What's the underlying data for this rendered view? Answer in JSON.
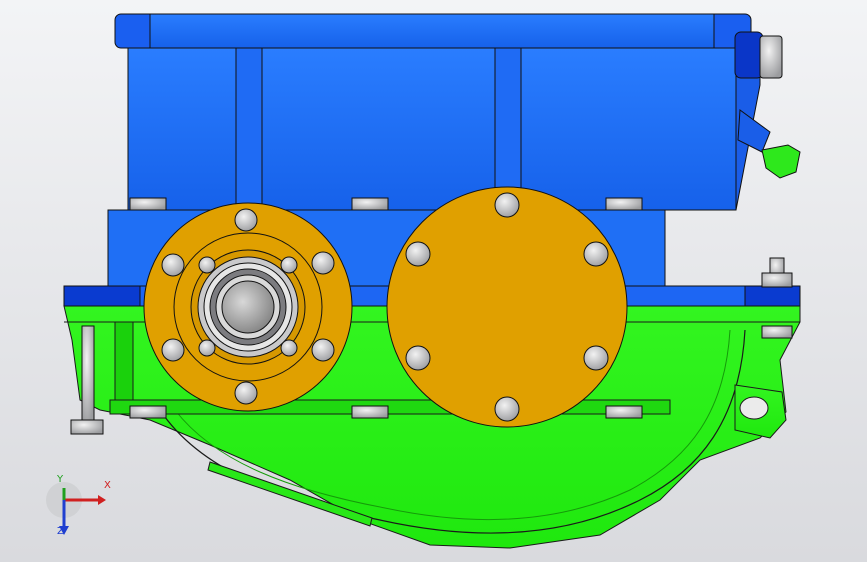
{
  "viewport": {
    "background": "#eceef1",
    "colors": {
      "housing_upper": "#1f6ff5",
      "housing_upper_dark": "#0a36c8",
      "housing_lower": "#21ef13",
      "housing_lower_dark": "#139e08",
      "cover": "#e0a000",
      "bolt": "#c9cacd",
      "outline": "#202020"
    }
  },
  "triad": {
    "x_label": "X",
    "y_label": "Y",
    "z_label": "Z",
    "x_color": "#d02020",
    "y_color": "#1fa01f",
    "z_color": "#1f3fd0"
  }
}
